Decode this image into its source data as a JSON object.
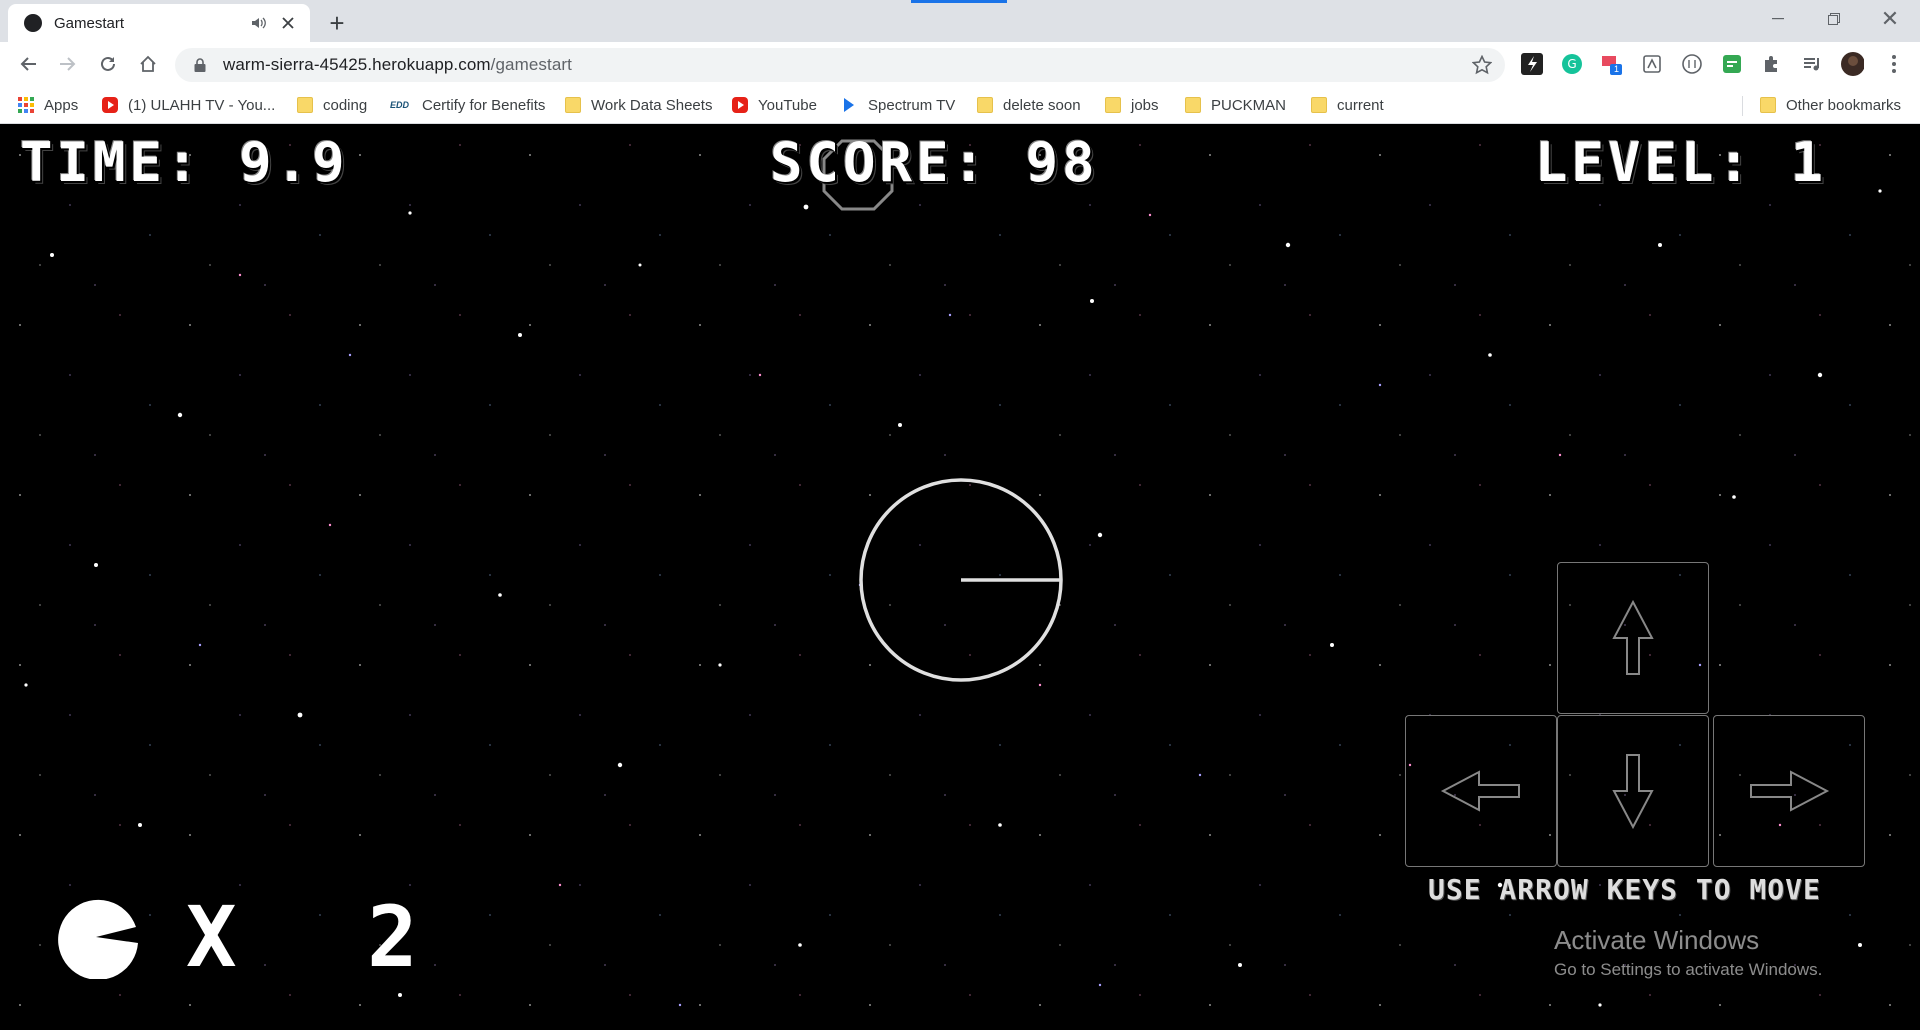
{
  "browser": {
    "tab": {
      "title": "Gamestart"
    },
    "new_tab_symbol": "+",
    "window_close_symbol": "✕",
    "url": {
      "host": "warm-sierra-45425.herokuapp.com",
      "path": "/gamestart"
    },
    "bookmarks": [
      {
        "label": "Apps",
        "icon": "apps-grid-icon"
      },
      {
        "label": "(1) ULAHH TV - You...",
        "icon": "youtube-icon"
      },
      {
        "label": "coding",
        "icon": "folder-icon"
      },
      {
        "label": "Certify for Benefits",
        "icon": "edd-icon",
        "icon_text": "EDD"
      },
      {
        "label": "Work Data Sheets",
        "icon": "folder-icon"
      },
      {
        "label": "YouTube",
        "icon": "youtube-icon"
      },
      {
        "label": "Spectrum TV",
        "icon": "spectrum-icon"
      },
      {
        "label": "delete soon",
        "icon": "folder-icon"
      },
      {
        "label": "jobs",
        "icon": "folder-icon"
      },
      {
        "label": "PUCKMAN",
        "icon": "folder-icon"
      },
      {
        "label": "current",
        "icon": "folder-icon"
      }
    ],
    "other_bookmarks": "Other bookmarks",
    "extension_badge": "1"
  },
  "game": {
    "time_label": "TIME:",
    "time_value": "9.9",
    "score_label": "SCORE:",
    "score_value": "98",
    "level_label": "LEVEL:",
    "level_value": "1",
    "lives_text": "X 2",
    "hint": "USE ARROW KEYS TO MOVE"
  },
  "windows_notice": {
    "title": "Activate Windows",
    "subtitle": "Go to Settings to activate Windows."
  },
  "colors": {
    "accent": "#1a73e8",
    "background": "#000000",
    "hud_text": "#ffffff"
  }
}
